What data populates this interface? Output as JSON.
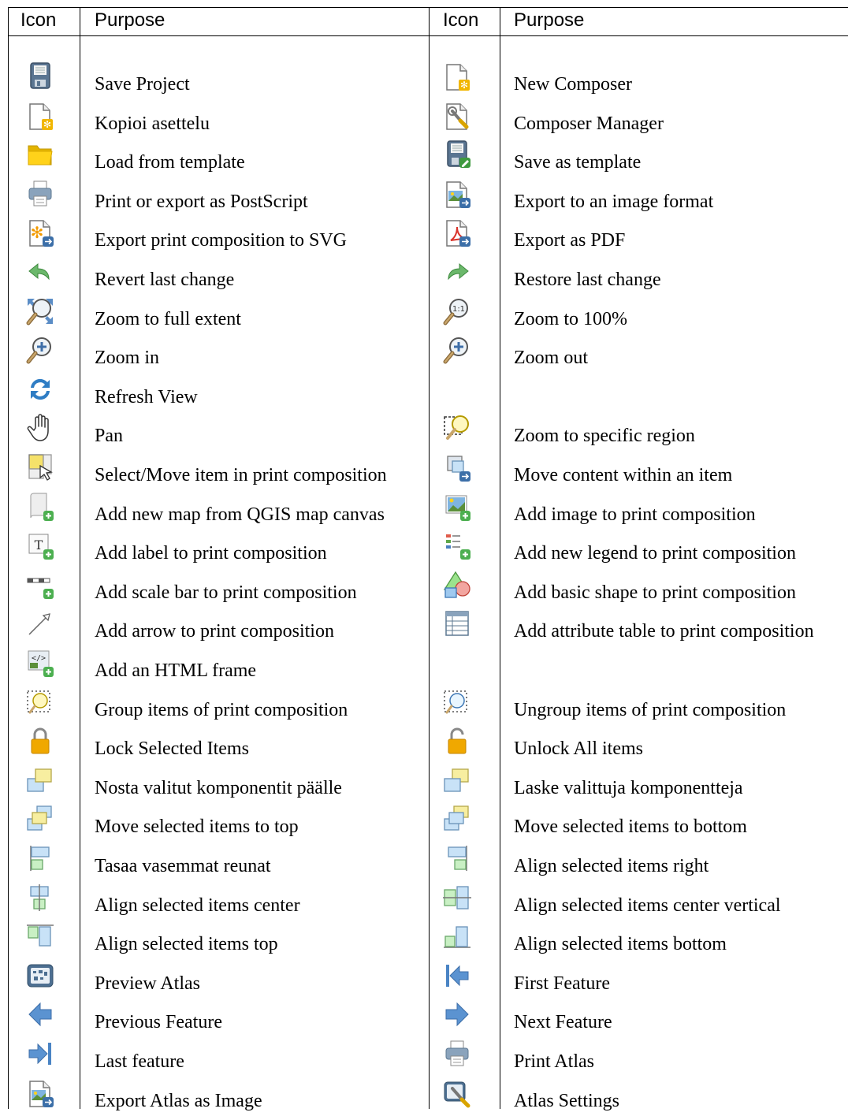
{
  "table": {
    "headers": [
      "Icon",
      "Purpose",
      "Icon",
      "Purpose"
    ],
    "rows": [
      {
        "left": {
          "icon": "save-project-icon",
          "purpose": "Save Project"
        },
        "right": {
          "icon": "new-composer-icon",
          "purpose": "New Composer"
        }
      },
      {
        "left": {
          "icon": "duplicate-composer-icon",
          "purpose": "Kopioi asettelu"
        },
        "right": {
          "icon": "composer-manager-icon",
          "purpose": "Composer Manager"
        }
      },
      {
        "left": {
          "icon": "folder-open-icon",
          "purpose": "Load from template"
        },
        "right": {
          "icon": "save-as-template-icon",
          "purpose": "Save as template"
        }
      },
      {
        "left": {
          "icon": "print-icon",
          "purpose": "Print or export as PostScript"
        },
        "right": {
          "icon": "export-image-icon",
          "purpose": "Export to an image format"
        }
      },
      {
        "left": {
          "icon": "export-svg-icon",
          "purpose": "Export print composition to SVG"
        },
        "right": {
          "icon": "export-pdf-icon",
          "purpose": "Export as PDF"
        }
      },
      {
        "left": {
          "icon": "undo-icon",
          "purpose": "Revert last change"
        },
        "right": {
          "icon": "redo-icon",
          "purpose": "Restore last change"
        }
      },
      {
        "left": {
          "icon": "zoom-full-icon",
          "purpose": "Zoom to full extent"
        },
        "right": {
          "icon": "zoom-actual-icon",
          "purpose": "Zoom to 100%"
        }
      },
      {
        "left": {
          "icon": "zoom-in-icon",
          "purpose": "Zoom in"
        },
        "right": {
          "icon": "zoom-out-icon",
          "purpose": "Zoom out"
        }
      },
      {
        "left": {
          "icon": "refresh-icon",
          "purpose": "Refresh View"
        },
        "right": {
          "icon": "",
          "purpose": ""
        }
      },
      {
        "left": {
          "icon": "pan-hand-icon",
          "purpose": "Pan"
        },
        "right": {
          "icon": "zoom-region-icon",
          "purpose": "Zoom to specific region"
        }
      },
      {
        "left": {
          "icon": "select-move-icon",
          "purpose": "Select/Move item in print composition"
        },
        "right": {
          "icon": "move-content-icon",
          "purpose": "Move content within an item"
        }
      },
      {
        "left": {
          "icon": "add-map-icon",
          "purpose": "Add new map from QGIS map canvas"
        },
        "right": {
          "icon": "add-image-icon",
          "purpose": "Add image to print composition"
        }
      },
      {
        "left": {
          "icon": "add-label-icon",
          "purpose": "Add label to print composition"
        },
        "right": {
          "icon": "add-legend-icon",
          "purpose": "Add new legend to print composition"
        }
      },
      {
        "left": {
          "icon": "add-scalebar-icon",
          "purpose": "Add scale bar to print composition"
        },
        "right": {
          "icon": "add-shape-icon",
          "purpose": "Add basic shape to print composition"
        }
      },
      {
        "left": {
          "icon": "add-arrow-icon",
          "purpose": "Add arrow to print composition"
        },
        "right": {
          "icon": "add-table-icon",
          "purpose": "Add attribute table to print composition"
        }
      },
      {
        "left": {
          "icon": "add-html-icon",
          "purpose": "Add an HTML frame"
        },
        "right": {
          "icon": "",
          "purpose": ""
        }
      },
      {
        "left": {
          "icon": "group-items-icon",
          "purpose": "Group items of print composition"
        },
        "right": {
          "icon": "ungroup-items-icon",
          "purpose": "Ungroup items of print composition"
        }
      },
      {
        "left": {
          "icon": "lock-icon",
          "purpose": "Lock Selected Items"
        },
        "right": {
          "icon": "unlock-icon",
          "purpose": "Unlock All items"
        }
      },
      {
        "left": {
          "icon": "raise-items-icon",
          "purpose": "Nosta valitut komponentit päälle"
        },
        "right": {
          "icon": "lower-items-icon",
          "purpose": "Laske valittuja komponentteja"
        }
      },
      {
        "left": {
          "icon": "move-to-top-icon",
          "purpose": "Move selected items to top"
        },
        "right": {
          "icon": "move-to-bottom-icon",
          "purpose": "Move selected items to bottom"
        }
      },
      {
        "left": {
          "icon": "align-left-icon",
          "purpose": "Tasaa vasemmat reunat"
        },
        "right": {
          "icon": "align-right-icon",
          "purpose": "Align selected items right"
        }
      },
      {
        "left": {
          "icon": "align-hcenter-icon",
          "purpose": "Align selected items center"
        },
        "right": {
          "icon": "align-vcenter-icon",
          "purpose": "Align selected items center vertical"
        }
      },
      {
        "left": {
          "icon": "align-top-icon",
          "purpose": "Align selected items top"
        },
        "right": {
          "icon": "align-bottom-icon",
          "purpose": "Align selected items bottom"
        }
      },
      {
        "left": {
          "icon": "preview-atlas-icon",
          "purpose": "Preview Atlas"
        },
        "right": {
          "icon": "first-feature-icon",
          "purpose": "First Feature"
        }
      },
      {
        "left": {
          "icon": "previous-feature-icon",
          "purpose": "Previous Feature"
        },
        "right": {
          "icon": "next-feature-icon",
          "purpose": "Next Feature"
        }
      },
      {
        "left": {
          "icon": "last-feature-icon",
          "purpose": "Last feature"
        },
        "right": {
          "icon": "print-atlas-icon",
          "purpose": "Print Atlas"
        }
      },
      {
        "left": {
          "icon": "export-atlas-image-icon",
          "purpose": "Export Atlas as Image"
        },
        "right": {
          "icon": "atlas-settings-icon",
          "purpose": "Atlas Settings"
        }
      }
    ]
  }
}
